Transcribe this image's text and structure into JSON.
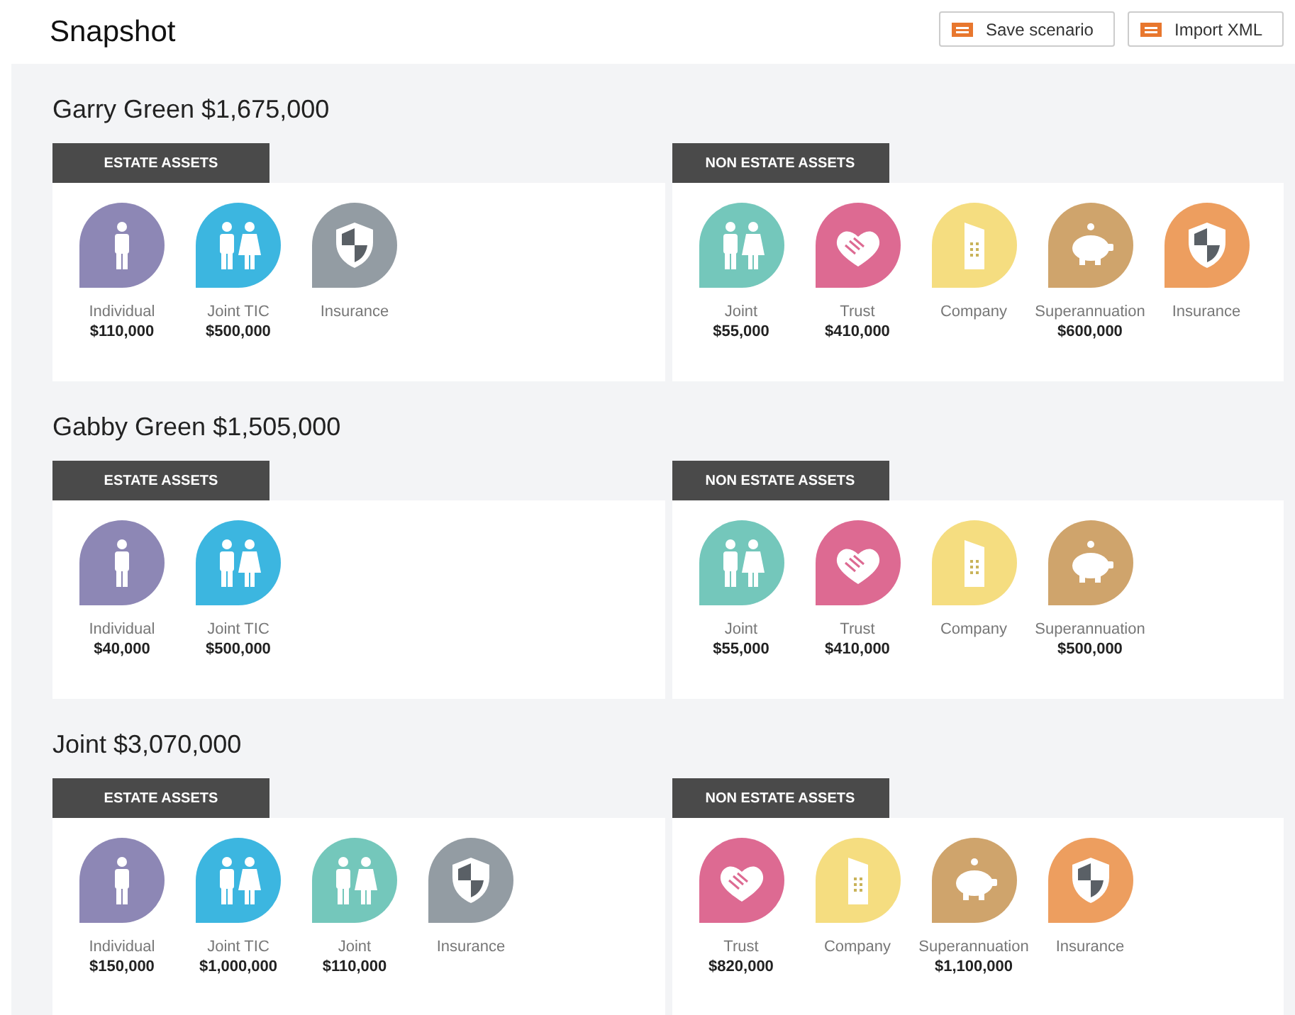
{
  "header": {
    "title": "Snapshot",
    "buttons": [
      {
        "label": "Save scenario"
      },
      {
        "label": "Import XML"
      }
    ]
  },
  "sections": [
    {
      "title": "Garry Green $1,675,000",
      "groups": [
        {
          "heading": "ESTATE ASSETS",
          "assets": [
            {
              "kind": "person",
              "color": "#8d87b5",
              "label": "Individual",
              "value": "$110,000"
            },
            {
              "kind": "couple",
              "color": "#3cb6e0",
              "label": "Joint TIC",
              "value": "$500,000"
            },
            {
              "kind": "shield",
              "color": "#939ca3",
              "label": "Insurance"
            }
          ]
        },
        {
          "heading": "NON ESTATE ASSETS",
          "assets": [
            {
              "kind": "couple",
              "color": "#74c7bb",
              "label": "Joint",
              "value": "$55,000"
            },
            {
              "kind": "handshake",
              "color": "#dd6a92",
              "label": "Trust",
              "value": "$410,000"
            },
            {
              "kind": "building",
              "color": "#f5dd80",
              "label": "Company"
            },
            {
              "kind": "piggy",
              "color": "#cfa46c",
              "label": "Superannuation",
              "value": "$600,000"
            },
            {
              "kind": "shield",
              "color": "#ed9e5f",
              "label": "Insurance"
            }
          ]
        }
      ]
    },
    {
      "title": "Gabby Green $1,505,000",
      "groups": [
        {
          "heading": "ESTATE ASSETS",
          "assets": [
            {
              "kind": "person",
              "color": "#8d87b5",
              "label": "Individual",
              "value": "$40,000"
            },
            {
              "kind": "couple",
              "color": "#3cb6e0",
              "label": "Joint TIC",
              "value": "$500,000"
            }
          ]
        },
        {
          "heading": "NON ESTATE ASSETS",
          "assets": [
            {
              "kind": "couple",
              "color": "#74c7bb",
              "label": "Joint",
              "value": "$55,000"
            },
            {
              "kind": "handshake",
              "color": "#dd6a92",
              "label": "Trust",
              "value": "$410,000"
            },
            {
              "kind": "building",
              "color": "#f5dd80",
              "label": "Company"
            },
            {
              "kind": "piggy",
              "color": "#cfa46c",
              "label": "Superannuation",
              "value": "$500,000"
            }
          ]
        }
      ]
    },
    {
      "title": "Joint $3,070,000",
      "groups": [
        {
          "heading": "ESTATE ASSETS",
          "assets": [
            {
              "kind": "person",
              "color": "#8d87b5",
              "label": "Individual",
              "value": "$150,000"
            },
            {
              "kind": "couple",
              "color": "#3cb6e0",
              "label": "Joint TIC",
              "value": "$1,000,000"
            },
            {
              "kind": "couple",
              "color": "#74c7bb",
              "label": "Joint",
              "value": "$110,000"
            },
            {
              "kind": "shield",
              "color": "#939ca3",
              "label": "Insurance"
            }
          ]
        },
        {
          "heading": "NON ESTATE ASSETS",
          "assets": [
            {
              "kind": "handshake",
              "color": "#dd6a92",
              "label": "Trust",
              "value": "$820,000"
            },
            {
              "kind": "building",
              "color": "#f5dd80",
              "label": "Company"
            },
            {
              "kind": "piggy",
              "color": "#cfa46c",
              "label": "Superannuation",
              "value": "$1,100,000"
            },
            {
              "kind": "shield",
              "color": "#ed9e5f",
              "label": "Insurance"
            }
          ]
        }
      ]
    }
  ]
}
